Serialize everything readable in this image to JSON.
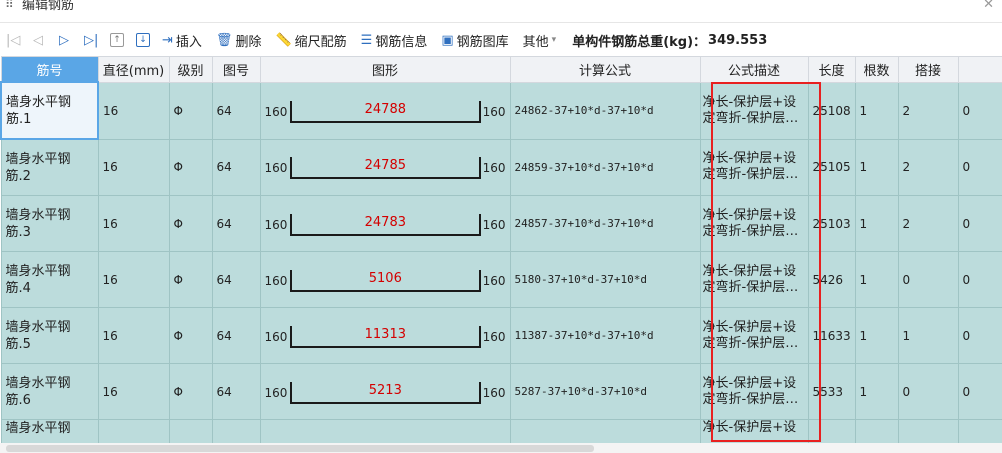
{
  "window": {
    "title": "编辑钢筋"
  },
  "toolbar": {
    "insert_label": "插入",
    "delete_label": "删除",
    "scale_label": "缩尺配筋",
    "info_label": "钢筋信息",
    "library_label": "钢筋图库",
    "other_label": "其他",
    "total_weight_label": "单构件钢筋总重(kg)：",
    "total_weight_value": "349.553"
  },
  "columns": [
    "筋号",
    "直径(mm)",
    "级别",
    "图号",
    "图形",
    "计算公式",
    "公式描述",
    "长度",
    "根数",
    "搭接"
  ],
  "rows": [
    {
      "name": "墙身水平钢筋.1",
      "diameter": "16",
      "grade": "Φ",
      "fig": "64",
      "left": "160",
      "middle": "24788",
      "right": "160",
      "formula": "24862-37+10*d-37+10*d",
      "desc": "净长-保护层+设定弯折-保护层…",
      "length": "25108",
      "count": "1",
      "lap": "2",
      "extra": "0"
    },
    {
      "name": "墙身水平钢筋.2",
      "diameter": "16",
      "grade": "Φ",
      "fig": "64",
      "left": "160",
      "middle": "24785",
      "right": "160",
      "formula": "24859-37+10*d-37+10*d",
      "desc": "净长-保护层+设定弯折-保护层…",
      "length": "25105",
      "count": "1",
      "lap": "2",
      "extra": "0"
    },
    {
      "name": "墙身水平钢筋.3",
      "diameter": "16",
      "grade": "Φ",
      "fig": "64",
      "left": "160",
      "middle": "24783",
      "right": "160",
      "formula": "24857-37+10*d-37+10*d",
      "desc": "净长-保护层+设定弯折-保护层…",
      "length": "25103",
      "count": "1",
      "lap": "2",
      "extra": "0"
    },
    {
      "name": "墙身水平钢筋.4",
      "diameter": "16",
      "grade": "Φ",
      "fig": "64",
      "left": "160",
      "middle": "5106",
      "right": "160",
      "formula": "5180-37+10*d-37+10*d",
      "desc": "净长-保护层+设定弯折-保护层…",
      "length": "5426",
      "count": "1",
      "lap": "0",
      "extra": "0"
    },
    {
      "name": "墙身水平钢筋.5",
      "diameter": "16",
      "grade": "Φ",
      "fig": "64",
      "left": "160",
      "middle": "11313",
      "right": "160",
      "formula": "11387-37+10*d-37+10*d",
      "desc": "净长-保护层+设定弯折-保护层…",
      "length": "11633",
      "count": "1",
      "lap": "1",
      "extra": "0"
    },
    {
      "name": "墙身水平钢筋.6",
      "diameter": "16",
      "grade": "Φ",
      "fig": "64",
      "left": "160",
      "middle": "5213",
      "right": "160",
      "formula": "5287-37+10*d-37+10*d",
      "desc": "净长-保护层+设定弯折-保护层…",
      "length": "5533",
      "count": "1",
      "lap": "0",
      "extra": "0"
    }
  ],
  "partial_row": {
    "name": "墙身水平钢",
    "desc": "净长-保护层+设"
  },
  "colors": {
    "row_bg": "#bcdcdc",
    "header_active": "#5aa6e6",
    "highlight_box": "#e82020",
    "shape_label": "#d40000"
  }
}
